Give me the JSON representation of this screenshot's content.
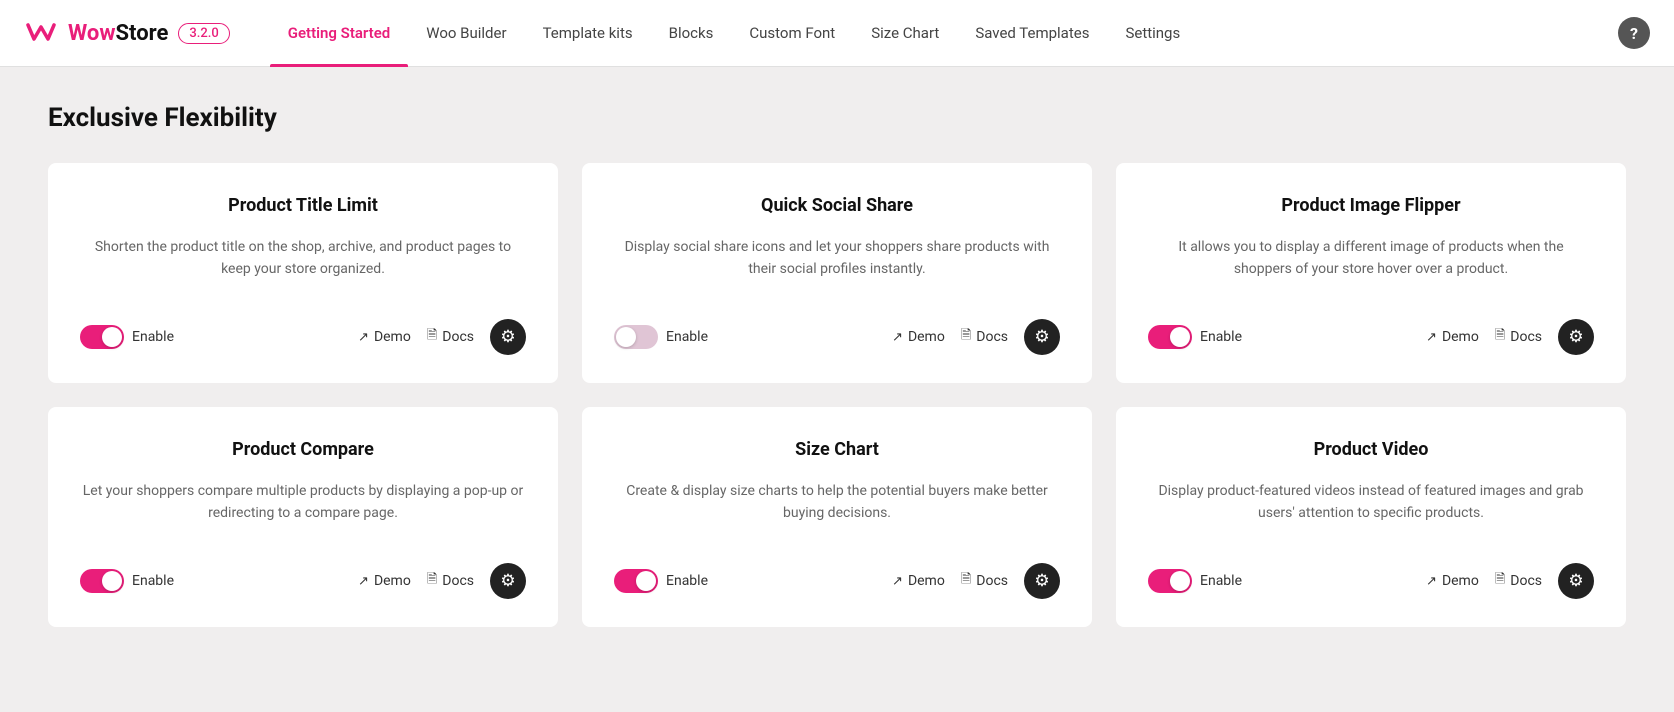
{
  "header": {
    "logo_text_wow": "Wow",
    "logo_text_store": "Store",
    "version": "3.2.0",
    "nav_items": [
      {
        "label": "Getting Started",
        "active": true
      },
      {
        "label": "Woo Builder",
        "active": false
      },
      {
        "label": "Template kits",
        "active": false
      },
      {
        "label": "Blocks",
        "active": false
      },
      {
        "label": "Custom Font",
        "active": false
      },
      {
        "label": "Size Chart",
        "active": false
      },
      {
        "label": "Saved Templates",
        "active": false
      },
      {
        "label": "Settings",
        "active": false
      }
    ],
    "help_label": "?"
  },
  "main": {
    "section_title": "Exclusive Flexibility",
    "cards": [
      {
        "id": "product-title-limit",
        "title": "Product Title Limit",
        "desc": "Shorten the product title on the shop, archive, and product pages to keep your store organized.",
        "enabled": true,
        "demo_label": "Demo",
        "docs_label": "Docs"
      },
      {
        "id": "quick-social-share",
        "title": "Quick Social Share",
        "desc": "Display social share icons and let your shoppers share products with their social profiles instantly.",
        "enabled": false,
        "demo_label": "Demo",
        "docs_label": "Docs"
      },
      {
        "id": "product-image-flipper",
        "title": "Product Image Flipper",
        "desc": "It allows you to display a different image of products when the shoppers of your store hover over a product.",
        "enabled": true,
        "demo_label": "Demo",
        "docs_label": "Docs"
      },
      {
        "id": "product-compare",
        "title": "Product Compare",
        "desc": "Let your shoppers compare multiple products by displaying a pop-up or redirecting to a compare page.",
        "enabled": true,
        "demo_label": "Demo",
        "docs_label": "Docs"
      },
      {
        "id": "size-chart",
        "title": "Size Chart",
        "desc": "Create & display size charts to help the potential buyers make better buying decisions.",
        "enabled": true,
        "demo_label": "Demo",
        "docs_label": "Docs"
      },
      {
        "id": "product-video",
        "title": "Product Video",
        "desc": "Display product-featured videos instead of featured images and grab users' attention to specific products.",
        "enabled": true,
        "demo_label": "Demo",
        "docs_label": "Docs"
      }
    ],
    "enable_label": "Enable"
  }
}
